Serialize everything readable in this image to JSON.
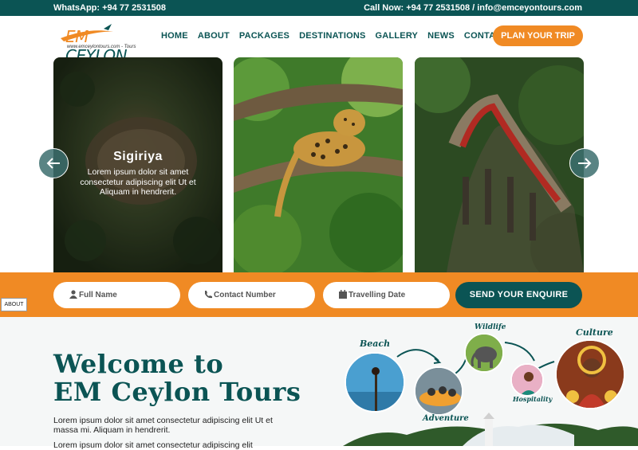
{
  "topbar": {
    "whatsapp": "WhatsApp: +94 77 2531508",
    "call": "Call Now: +94 77 2531508 / info@emceyontours.com"
  },
  "logo": {
    "brand_em": "EM",
    "brand_name": " CEYLON",
    "tagline": "www.emceylontours.com - Tours"
  },
  "nav": {
    "items": [
      "HOME",
      "ABOUT",
      "PACKAGES",
      "DESTINATIONS",
      "GALLERY",
      "NEWS",
      "CONTACT"
    ],
    "cta": "PLAN YOUR TRIP"
  },
  "carousel": {
    "slides": [
      {
        "title": "Sigiriya",
        "text": "Lorem ipsum dolor sit amet consectetur adipiscing elit Ut et  Aliquam in hendrerit."
      }
    ]
  },
  "enquiry": {
    "full_name_placeholder": "Full Name",
    "contact_placeholder": "Contact Number",
    "date_placeholder": "Travelling Date",
    "submit": "SEND YOUR ENQUIRE"
  },
  "about_tag": "ABOUT",
  "about": {
    "title_line1": "Welcome to",
    "title_line2": "EM Ceylon Tours",
    "para1": "Lorem ipsum dolor sit amet consectetur adipiscing elit Ut et massa mi. Aliquam in hendrerit.",
    "para2": "Lorem ipsum dolor sit amet consectetur adipiscing elit",
    "features": {
      "beach": "Beach",
      "adventure": "Adventure",
      "wildlife": "Wildlife",
      "hospitality": "Hospitality",
      "culture": "Culture"
    }
  },
  "colors": {
    "teal": "#0b5454",
    "orange": "#f08a24"
  }
}
